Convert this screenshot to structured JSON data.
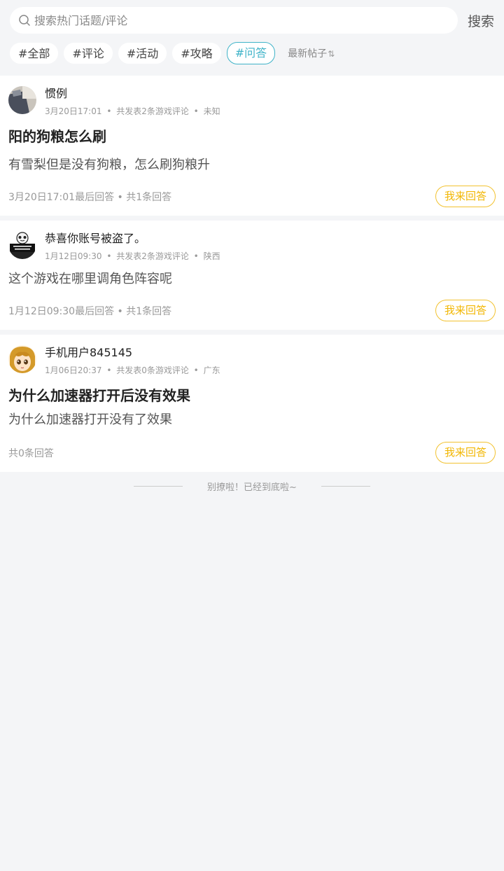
{
  "search": {
    "placeholder": "搜索热门话题/评论",
    "button_label": "搜索"
  },
  "tags": [
    {
      "label": "#全部",
      "active": false
    },
    {
      "label": "#评论",
      "active": false
    },
    {
      "label": "#活动",
      "active": false
    },
    {
      "label": "#攻略",
      "active": false
    },
    {
      "label": "#问答",
      "active": true
    }
  ],
  "sort": {
    "label": "最新帖子",
    "icon": "sort-arrows-icon"
  },
  "posts": [
    {
      "username": "惯例",
      "time": "3月20日17:01",
      "stats": "共发表2条游戏评论",
      "location": "未知",
      "title": "阳的狗粮怎么刷",
      "body": "有雪梨但是没有狗粮，怎么刷狗粮升",
      "footer": "3月20日17:01最后回答 • 共1条回答",
      "answer_label": "我来回答"
    },
    {
      "username": "恭喜你账号被盗了。",
      "time": "1月12日09:30",
      "stats": "共发表2条游戏评论",
      "location": "陕西",
      "title": "",
      "body": "这个游戏在哪里调角色阵容呢",
      "footer": "1月12日09:30最后回答 • 共1条回答",
      "answer_label": "我来回答"
    },
    {
      "username": "手机用户845145",
      "time": "1月06日20:37",
      "stats": "共发表0条游戏评论",
      "location": "广东",
      "title": "为什么加速器打开后没有效果",
      "body": "为什么加速器打开没有了效果",
      "footer": "共0条回答",
      "answer_label": "我来回答"
    }
  ],
  "end_text": "别撩啦！已经到底啦~",
  "colors": {
    "accent": "#3fb3c8",
    "answer": "#f2b705",
    "background": "#f4f5f7"
  }
}
